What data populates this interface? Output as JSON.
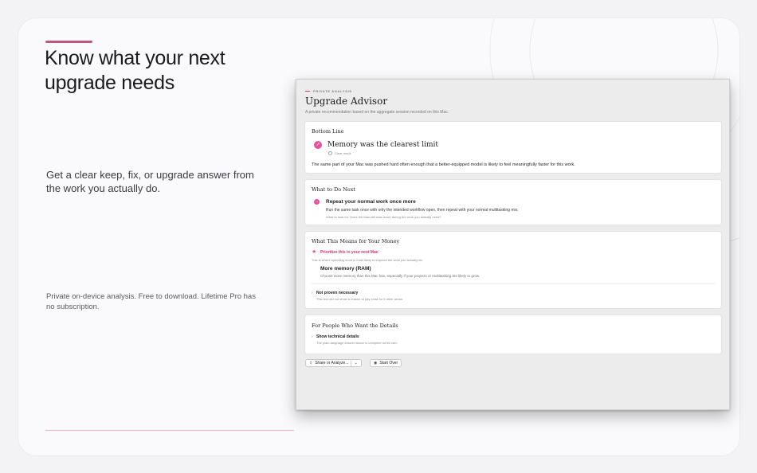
{
  "marketing": {
    "headline": "Know what your next upgrade needs",
    "subhead": "Get a clear keep, fix, or upgrade answer from the work you actually do.",
    "footnote": "Private on-device analysis. Free to download. Lifetime Pro has no subscription."
  },
  "window": {
    "eyebrow": "PRIVATE ANALYSIS",
    "title": "Upgrade Advisor",
    "description": "A private recommendation based on the aggregate session recorded on this Mac.",
    "bottom_line": {
      "heading": "Bottom Line",
      "title": "Memory was the clearest limit",
      "status": "Clear result",
      "body": "The same part of your Mac was pushed hard often enough that a better-equipped model is likely to feel meaningfully faster for this work."
    },
    "next": {
      "heading": "What to Do Next",
      "step_title": "Repeat your normal work once more",
      "step_desc": "Run the same task once with only the intended workflow open, then repeat with your normal multitasking mix.",
      "hint": "What to look for: Does the Mac still slow down during the work you actually need?"
    },
    "money": {
      "heading": "What This Means for Your Money",
      "priority": "Prioritize this in your next Mac",
      "priority_note": "This is where spending more is most likely to improve the work you actually do.",
      "item_title": "More memory (RAM)",
      "item_desc": "Choose more memory than this Mac has, especially if your projects or multitasking are likely to grow.",
      "not_proven": "Not proven necessary",
      "not_proven_desc": "This test did not show a reason to pay extra for 5 other areas."
    },
    "details": {
      "heading": "For People Who Want the Details",
      "toggle": "Show technical details",
      "toggle_desc": "The plain-language answer above is complete on its own."
    },
    "buttons": {
      "share": "Share or Analyze...",
      "start_over": "Start Over"
    }
  },
  "icons": {
    "bottom_line": "arrow-up-right-icon",
    "next": "arrow-right-icon",
    "priority": "star-icon",
    "share": "share-icon",
    "start_over": "restart-icon"
  },
  "colors": {
    "accent": "#c2577e",
    "pink": "#e7509a",
    "window_bg": "#ececec"
  }
}
